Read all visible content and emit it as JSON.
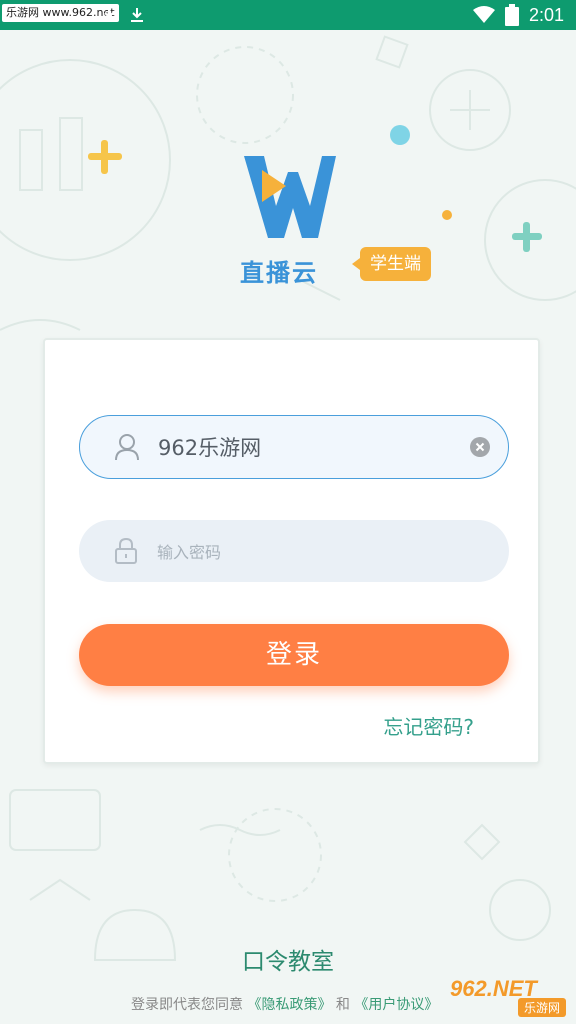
{
  "status_bar": {
    "watermark": "乐游网 www.962.net",
    "time": "2:01"
  },
  "brand": {
    "name": "直播云",
    "tag": "学生端",
    "colors": {
      "blue": "#3a93d8",
      "yellow": "#f6b13b"
    }
  },
  "login_form": {
    "username_value": "962乐游网",
    "password_placeholder": "输入密码",
    "login_label": "登录",
    "forgot_label": "忘记密码?"
  },
  "footer": {
    "classroom_label": "口令教室",
    "agree_prefix": "登录即代表您同意",
    "privacy_link": "《隐私政策》",
    "and_text": "和",
    "terms_link": "《用户协议》"
  },
  "watermark_bottom": {
    "logo_text": "962.NET",
    "sub_text": "乐游网"
  },
  "colors": {
    "status_bar": "#0e9b6f",
    "login_button": "#ff7f44",
    "link": "#35a08c"
  },
  "icons": [
    "wifi-icon",
    "battery-icon",
    "download-icon",
    "user-icon",
    "lock-icon",
    "clear-icon"
  ]
}
